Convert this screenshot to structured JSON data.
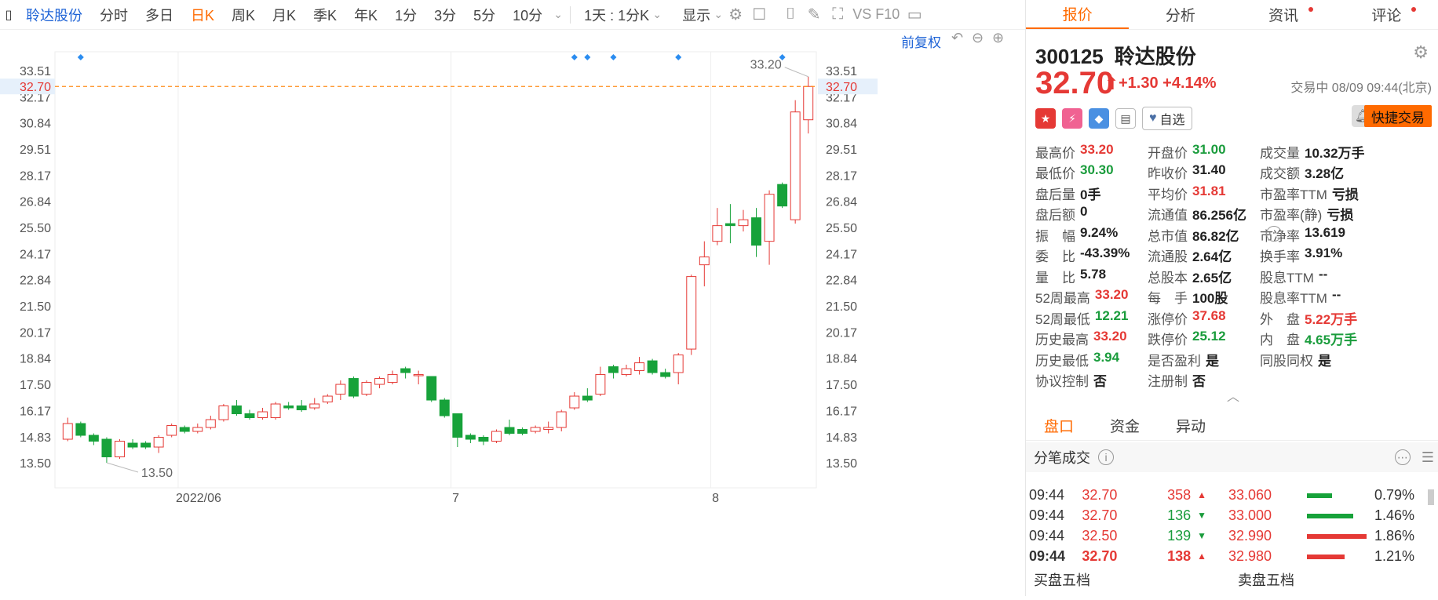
{
  "toolbar": {
    "stock_name": "聆达股份",
    "items": [
      "分时",
      "多日",
      "日K",
      "周K",
      "月K",
      "季K",
      "年K",
      "1分",
      "3分",
      "5分",
      "10分"
    ],
    "active": "日K",
    "interval_select": "1天 : 1分K",
    "display_label": "显示",
    "f10": "VS F10"
  },
  "chart": {
    "adjust_label": "前复权",
    "current_price_tag": "32.70",
    "high_label": "33.20",
    "low_label": "13.50",
    "colors": {
      "up": "#e53935",
      "down": "#17a23a",
      "marker": "#2a8cf0",
      "price_line": "#ff8c1a"
    }
  },
  "chart_data": {
    "type": "candlestick",
    "y_ticks": [
      "33.51",
      "32.17",
      "30.84",
      "29.51",
      "28.17",
      "26.84",
      "25.50",
      "24.17",
      "22.84",
      "21.50",
      "20.17",
      "18.84",
      "17.50",
      "16.17",
      "14.83",
      "13.50"
    ],
    "ylim": [
      13.5,
      33.51
    ],
    "x_labels": [
      "2022/06",
      "7",
      "8"
    ],
    "current_price": 32.7,
    "candles": [
      {
        "o": 14.7,
        "c": 15.5,
        "h": 15.8,
        "l": 14.6
      },
      {
        "o": 15.5,
        "c": 14.9,
        "h": 15.6,
        "l": 14.8
      },
      {
        "o": 14.9,
        "c": 14.6,
        "h": 15.0,
        "l": 14.4
      },
      {
        "o": 14.7,
        "c": 13.8,
        "h": 14.8,
        "l": 13.5
      },
      {
        "o": 13.8,
        "c": 14.6,
        "h": 14.7,
        "l": 13.7
      },
      {
        "o": 14.5,
        "c": 14.3,
        "h": 14.7,
        "l": 14.2
      },
      {
        "o": 14.5,
        "c": 14.3,
        "h": 14.6,
        "l": 14.2
      },
      {
        "o": 14.3,
        "c": 14.8,
        "h": 14.9,
        "l": 14.0
      },
      {
        "o": 14.9,
        "c": 15.4,
        "h": 15.5,
        "l": 14.8
      },
      {
        "o": 15.3,
        "c": 15.1,
        "h": 15.4,
        "l": 15.0
      },
      {
        "o": 15.1,
        "c": 15.3,
        "h": 15.5,
        "l": 15.0
      },
      {
        "o": 15.3,
        "c": 15.7,
        "h": 15.9,
        "l": 15.2
      },
      {
        "o": 15.7,
        "c": 16.4,
        "h": 16.5,
        "l": 15.6
      },
      {
        "o": 16.4,
        "c": 16.0,
        "h": 16.7,
        "l": 15.9
      },
      {
        "o": 16.0,
        "c": 15.8,
        "h": 16.2,
        "l": 15.7
      },
      {
        "o": 15.8,
        "c": 16.1,
        "h": 16.3,
        "l": 15.7
      },
      {
        "o": 15.8,
        "c": 16.5,
        "h": 16.6,
        "l": 15.7
      },
      {
        "o": 16.4,
        "c": 16.3,
        "h": 16.6,
        "l": 16.2
      },
      {
        "o": 16.4,
        "c": 16.2,
        "h": 16.7,
        "l": 16.1
      },
      {
        "o": 16.3,
        "c": 16.5,
        "h": 16.8,
        "l": 16.2
      },
      {
        "o": 16.6,
        "c": 16.9,
        "h": 17.0,
        "l": 16.5
      },
      {
        "o": 17.0,
        "c": 17.5,
        "h": 17.7,
        "l": 16.7
      },
      {
        "o": 17.8,
        "c": 16.9,
        "h": 17.9,
        "l": 16.8
      },
      {
        "o": 17.0,
        "c": 17.6,
        "h": 17.7,
        "l": 16.9
      },
      {
        "o": 17.5,
        "c": 17.8,
        "h": 17.9,
        "l": 17.3
      },
      {
        "o": 17.6,
        "c": 18.0,
        "h": 18.2,
        "l": 17.5
      },
      {
        "o": 18.3,
        "c": 18.1,
        "h": 18.4,
        "l": 17.8
      },
      {
        "o": 18.0,
        "c": 18.0,
        "h": 18.2,
        "l": 17.5
      },
      {
        "o": 17.9,
        "c": 16.7,
        "h": 17.9,
        "l": 16.6
      },
      {
        "o": 16.7,
        "c": 15.9,
        "h": 16.8,
        "l": 15.8
      },
      {
        "o": 16.0,
        "c": 14.8,
        "h": 16.0,
        "l": 14.3
      },
      {
        "o": 14.9,
        "c": 14.7,
        "h": 15.0,
        "l": 14.5
      },
      {
        "o": 14.8,
        "c": 14.6,
        "h": 14.9,
        "l": 14.4
      },
      {
        "o": 14.6,
        "c": 15.1,
        "h": 15.2,
        "l": 14.5
      },
      {
        "o": 15.3,
        "c": 15.0,
        "h": 15.7,
        "l": 14.9
      },
      {
        "o": 15.2,
        "c": 15.0,
        "h": 15.3,
        "l": 14.9
      },
      {
        "o": 15.1,
        "c": 15.3,
        "h": 15.4,
        "l": 15.0
      },
      {
        "o": 15.2,
        "c": 15.3,
        "h": 15.6,
        "l": 15.0
      },
      {
        "o": 15.3,
        "c": 16.1,
        "h": 16.2,
        "l": 15.1
      },
      {
        "o": 16.3,
        "c": 16.9,
        "h": 17.1,
        "l": 16.2
      },
      {
        "o": 16.9,
        "c": 16.7,
        "h": 17.3,
        "l": 16.6
      },
      {
        "o": 17.0,
        "c": 18.0,
        "h": 18.4,
        "l": 16.9
      },
      {
        "o": 18.4,
        "c": 18.1,
        "h": 18.5,
        "l": 17.8
      },
      {
        "o": 18.0,
        "c": 18.3,
        "h": 18.5,
        "l": 17.9
      },
      {
        "o": 18.2,
        "c": 18.6,
        "h": 18.9,
        "l": 18.0
      },
      {
        "o": 18.7,
        "c": 18.1,
        "h": 18.8,
        "l": 18.0
      },
      {
        "o": 18.1,
        "c": 17.9,
        "h": 18.3,
        "l": 17.8
      },
      {
        "o": 18.1,
        "c": 19.0,
        "h": 19.1,
        "l": 17.5
      },
      {
        "o": 19.3,
        "c": 23.0,
        "h": 23.1,
        "l": 19.0
      },
      {
        "o": 23.6,
        "c": 24.0,
        "h": 24.8,
        "l": 22.5
      },
      {
        "o": 24.8,
        "c": 25.6,
        "h": 26.5,
        "l": 24.6
      },
      {
        "o": 25.7,
        "c": 25.6,
        "h": 26.7,
        "l": 24.7
      },
      {
        "o": 25.6,
        "c": 25.9,
        "h": 26.4,
        "l": 25.3
      },
      {
        "o": 26.0,
        "c": 24.6,
        "h": 26.5,
        "l": 24.0
      },
      {
        "o": 24.8,
        "c": 27.2,
        "h": 27.4,
        "l": 23.6
      },
      {
        "o": 27.7,
        "c": 26.6,
        "h": 27.8,
        "l": 26.5
      },
      {
        "o": 25.9,
        "c": 31.4,
        "h": 32.0,
        "l": 25.7
      },
      {
        "o": 31.0,
        "c": 32.7,
        "h": 33.2,
        "l": 30.3
      }
    ],
    "event_markers_at": [
      1,
      39,
      40,
      42,
      47,
      55
    ]
  },
  "quote": {
    "code": "300125",
    "name": "聆达股份",
    "price": "32.70",
    "arrow": "⬆",
    "change": "+1.30 +4.14%",
    "status": "交易中 08/09 09:44(北京)",
    "watch_label": "自选",
    "trade_label": "快捷交易",
    "tabs": [
      "报价",
      "分析",
      "资讯",
      "评论"
    ],
    "fields": [
      [
        [
          "最高价",
          "33.20",
          "red"
        ],
        [
          "开盘价",
          "31.00",
          "green"
        ],
        [
          "成交量",
          "10.32万手",
          ""
        ]
      ],
      [
        [
          "最低价",
          "30.30",
          "green"
        ],
        [
          "昨收价",
          "31.40",
          ""
        ],
        [
          "成交额",
          "3.28亿",
          ""
        ]
      ],
      [
        [
          "盘后量",
          "0手",
          ""
        ],
        [
          "平均价",
          "31.81",
          "red"
        ],
        [
          "市盈率TTM",
          "亏损",
          ""
        ]
      ],
      [
        [
          "盘后额",
          "0",
          ""
        ],
        [
          "流通值",
          "86.256亿",
          ""
        ],
        [
          "市盈率(静)",
          "亏损",
          ""
        ]
      ],
      [
        [
          "振　幅",
          "9.24%",
          ""
        ],
        [
          "总市值",
          "86.82亿",
          ""
        ],
        [
          "市净率",
          "13.619",
          ""
        ]
      ],
      [
        [
          "委　比",
          "-43.39%",
          ""
        ],
        [
          "流通股",
          "2.64亿",
          ""
        ],
        [
          "换手率",
          "3.91%",
          ""
        ]
      ],
      [
        [
          "量　比",
          "5.78",
          ""
        ],
        [
          "总股本",
          "2.65亿",
          ""
        ],
        [
          "股息TTM",
          "--",
          ""
        ]
      ],
      [
        [
          "52周最高",
          "33.20",
          "red"
        ],
        [
          "每　手",
          "100股",
          ""
        ],
        [
          "股息率TTM",
          "--",
          ""
        ]
      ],
      [
        [
          "52周最低",
          "12.21",
          "green"
        ],
        [
          "涨停价",
          "37.68",
          "red"
        ],
        [
          "外　盘",
          "5.22万手",
          "red"
        ]
      ],
      [
        [
          "历史最高",
          "33.20",
          "red"
        ],
        [
          "跌停价",
          "25.12",
          "green"
        ],
        [
          "内　盘",
          "4.65万手",
          "green"
        ]
      ],
      [
        [
          "历史最低",
          "3.94",
          "green"
        ],
        [
          "是否盈利",
          "是",
          ""
        ],
        [
          "同股同权",
          "是",
          ""
        ]
      ],
      [
        [
          "协议控制",
          "否",
          ""
        ],
        [
          "注册制",
          "否",
          ""
        ],
        [
          "",
          "",
          ""
        ]
      ]
    ]
  },
  "subtabs": [
    "盘口",
    "资金",
    "异动"
  ],
  "ticks": {
    "title": "分笔成交",
    "rows": [
      {
        "time": "09:44",
        "price": "32.70",
        "vol": "358",
        "dir": "up"
      },
      {
        "time": "09:44",
        "price": "32.70",
        "vol": "136",
        "dir": "down"
      },
      {
        "time": "09:44",
        "price": "32.50",
        "vol": "139",
        "dir": "down"
      },
      {
        "time": "09:44",
        "price": "32.70",
        "vol": "138",
        "dir": "up"
      }
    ]
  },
  "orders": {
    "rows": [
      {
        "price": "33.060",
        "pct": "0.79%",
        "bar": 0.15,
        "color": "#17a23a"
      },
      {
        "price": "33.000",
        "pct": "1.46%",
        "bar": 0.28,
        "color": "#17a23a"
      },
      {
        "price": "32.990",
        "pct": "1.86%",
        "bar": 0.36,
        "color": "#e53935"
      },
      {
        "price": "32.980",
        "pct": "1.21%",
        "bar": 0.23,
        "color": "#e53935"
      }
    ],
    "buy_label": "买盘五档",
    "sell_label": "卖盘五档"
  }
}
